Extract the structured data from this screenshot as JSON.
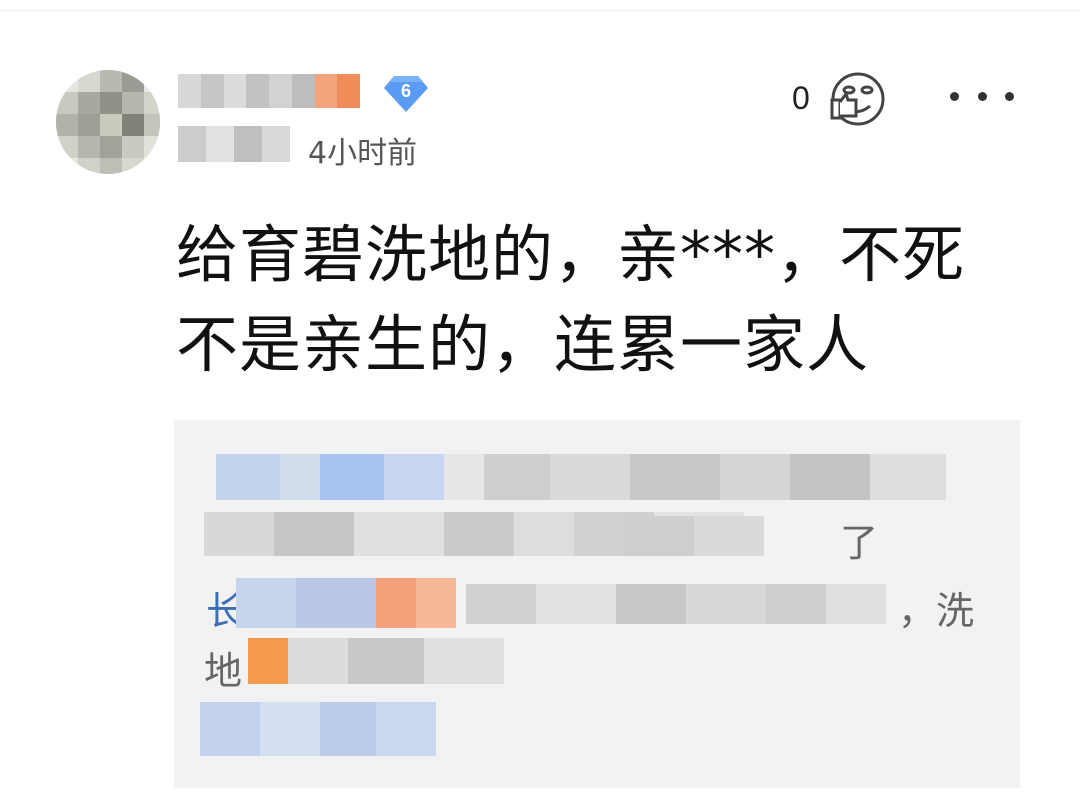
{
  "level_badge": {
    "value": "6",
    "color": "#5a9bf5"
  },
  "post_meta": {
    "time_ago": "4小时前"
  },
  "like": {
    "count": "0",
    "icon": "thumbs-up-face-icon"
  },
  "more": {
    "icon": "more-dots-icon"
  },
  "comment": {
    "line1": "给育碧洗地的，亲***，不死",
    "line2": "不是亲生的，连累一家人"
  },
  "quote": {
    "fragment_a": "了",
    "fragment_b": "长",
    "fragment_c": "，洗",
    "fragment_d": "地"
  }
}
